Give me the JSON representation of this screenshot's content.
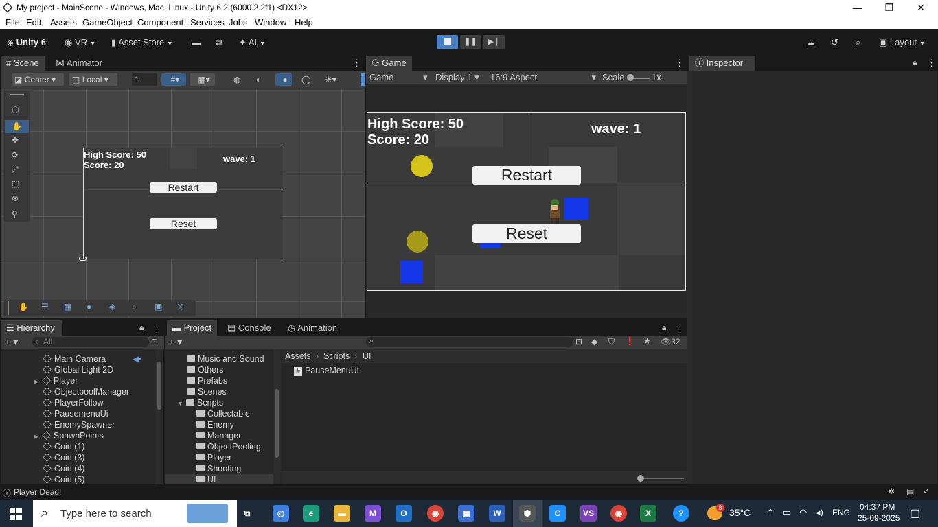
{
  "window": {
    "title": "My project - MainScene - Windows, Mac, Linux - Unity 6.2 (6000.2.2f1) <DX12>",
    "minimize": "—",
    "maximize": "❐",
    "close": "✕"
  },
  "menu": [
    "File",
    "Edit",
    "Assets",
    "GameObject",
    "Component",
    "Services",
    "Jobs",
    "Window",
    "Help"
  ],
  "toolbar": {
    "account": "Unity 6",
    "vr": "VR",
    "asset_store": "Asset Store",
    "ai": "AI",
    "layout": "Layout"
  },
  "scene_panel": {
    "tabs": [
      "Scene",
      "Animator"
    ],
    "pivot": "Center",
    "space": "Local",
    "snap_value": "1",
    "ui": {
      "high_score": "High Score: 50",
      "score": "Score: 20",
      "wave": "wave: 1",
      "restart": "Restart",
      "reset": "Reset"
    }
  },
  "game_panel": {
    "tab": "Game",
    "mode": "Game",
    "display": "Display 1",
    "aspect": "16:9 Aspect",
    "scale_label": "Scale",
    "scale_value": "1x",
    "ui": {
      "high_score": "High Score: 50",
      "score": "Score: 20",
      "wave": "wave: 1",
      "restart": "Restart",
      "reset": "Reset"
    }
  },
  "inspector": {
    "tab": "Inspector"
  },
  "hierarchy": {
    "tab": "Hierarchy",
    "search_placeholder": "All",
    "items": [
      {
        "label": "Main Camera",
        "expandable": false
      },
      {
        "label": "Global Light 2D",
        "expandable": false
      },
      {
        "label": "Player",
        "expandable": true
      },
      {
        "label": "ObjectpoolManager",
        "expandable": false
      },
      {
        "label": "PlayerFollow",
        "expandable": false
      },
      {
        "label": "PausemenuUi",
        "expandable": false
      },
      {
        "label": "EnemySpawner",
        "expandable": false
      },
      {
        "label": "SpawnPoints",
        "expandable": true
      },
      {
        "label": "Coin (1)",
        "expandable": false
      },
      {
        "label": "Coin (3)",
        "expandable": false
      },
      {
        "label": "Coin (4)",
        "expandable": false
      },
      {
        "label": "Coin (5)",
        "expandable": false
      }
    ]
  },
  "project": {
    "tabs": [
      "Project",
      "Console",
      "Animation"
    ],
    "hidden_count": "32",
    "folders": [
      {
        "label": "Music and Sound",
        "indent": 1
      },
      {
        "label": "Others",
        "indent": 1
      },
      {
        "label": "Prefabs",
        "indent": 1
      },
      {
        "label": "Scenes",
        "indent": 1
      },
      {
        "label": "Scripts",
        "indent": 1,
        "expanded": true
      },
      {
        "label": "Collectable",
        "indent": 2
      },
      {
        "label": "Enemy",
        "indent": 2
      },
      {
        "label": "Manager",
        "indent": 2
      },
      {
        "label": "ObjectPooling",
        "indent": 2
      },
      {
        "label": "Player",
        "indent": 2
      },
      {
        "label": "Shooting",
        "indent": 2
      },
      {
        "label": "UI",
        "indent": 2,
        "selected": true
      }
    ],
    "breadcrumb": [
      "Assets",
      "Scripts",
      "UI"
    ],
    "files": [
      "PauseMenuUi"
    ]
  },
  "status": {
    "message": "Player Dead!"
  },
  "taskbar": {
    "search_placeholder": "Type here to search",
    "temperature": "35°C",
    "language": "ENG",
    "time": "04:37 PM",
    "date": "25-09-2025",
    "weather_badge": "8"
  },
  "colors": {
    "accent": "#4a90d9",
    "coin": "#d4c41a",
    "enemy": "#1336e6",
    "panel_bg": "#282828"
  }
}
